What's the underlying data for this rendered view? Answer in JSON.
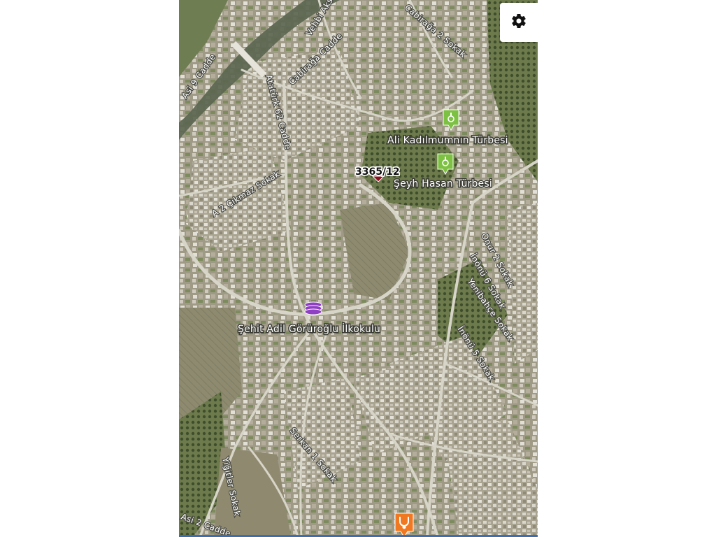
{
  "map": {
    "type": "satellite",
    "colors": {
      "vegetation": "#6f7d52",
      "urban": "#b9b6a8",
      "river": "#5c6650",
      "road": "#d7d4c8",
      "accent_strip": "#3d6fb0"
    }
  },
  "controls": {
    "settings_icon": "gear-icon"
  },
  "parcel": {
    "label": "3365/12",
    "marker_color": "#8a1020"
  },
  "pois": [
    {
      "name": "Ali Kadılmumnın Türbesi",
      "icon": "tomb-pin-icon",
      "color": "#7dc142"
    },
    {
      "name": "Şeyh Hasan Türbesi",
      "icon": "tomb-pin-icon",
      "color": "#7dc142"
    },
    {
      "name": "Şehit Adil Görüroğlu İlkokulu",
      "icon": "school-icon",
      "color": "#8e3fc4"
    },
    {
      "name": "",
      "icon": "vet-clinic-icon",
      "color": "#f07820"
    }
  ],
  "roads": [
    "Vehbi Aksoy",
    "Cabirağa Cadde",
    "Cabirağa 2 Sokak",
    "Asi 9 Cadde",
    "Atatürk 62 Cadde",
    "A 2 Çıkmaz Sokak",
    "Onur 2 Sokak",
    "İnönü 6 Sokak",
    "Yenibahçe Sokak",
    "İnönü 5 Sokak",
    "Serkan 1 Sokak",
    "Yiğitler Sokak",
    "Asi 2 Cadde"
  ]
}
